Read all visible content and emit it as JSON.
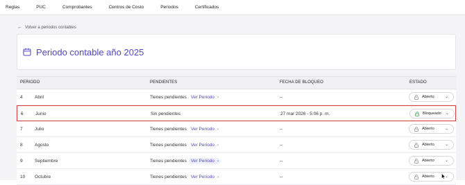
{
  "nav": {
    "items": [
      "Reglas",
      "PUC",
      "Comprobantes",
      "Centros de Costo",
      "Periodos",
      "Certificados"
    ]
  },
  "back_link": {
    "label": "Volver a periodos contables"
  },
  "page": {
    "title": "Periodo contable año 2025"
  },
  "table": {
    "headers": {
      "periodo": "PERIODO",
      "pendientes": "PENDIENTES",
      "fecha": "FECHA DE BLOQUEO",
      "estado": "ESTADO"
    },
    "link_label": "Ver Periodo",
    "rows": [
      {
        "num": "4",
        "mes": "Abril",
        "pendientes": "Tienes pendientes",
        "fecha": "--",
        "estado": "Abierto"
      },
      {
        "num": "6",
        "mes": "Junio",
        "pendientes": "Sin pendientes",
        "fecha": "27 mar 2026 - 5:06 p. m.",
        "estado": "Bloqueado"
      },
      {
        "num": "7",
        "mes": "Julio",
        "pendientes": "Tienes pendientes",
        "fecha": "--",
        "estado": "Abierto"
      },
      {
        "num": "8",
        "mes": "Agosto",
        "pendientes": "Tienes pendientes",
        "fecha": "--",
        "estado": "Abierto"
      },
      {
        "num": "9",
        "mes": "Septiembre",
        "pendientes": "Tienes pendientes",
        "fecha": "--",
        "estado": "Abierto"
      },
      {
        "num": "10",
        "mes": "Octubre",
        "pendientes": "Tienes pendientes",
        "fecha": "--",
        "estado": "Abierto"
      }
    ]
  },
  "colors": {
    "accent": "#4f46c8",
    "highlight_border": "#d9383c",
    "locked_icon": "#3aa15a",
    "open_icon": "#888888"
  },
  "icons": {
    "back": "arrow-left-icon",
    "title": "calendar-icon",
    "link": "chevron-right-icon",
    "status_open": "lock-open-icon",
    "status_locked": "lock-icon",
    "dropdown": "chevron-down-icon"
  }
}
